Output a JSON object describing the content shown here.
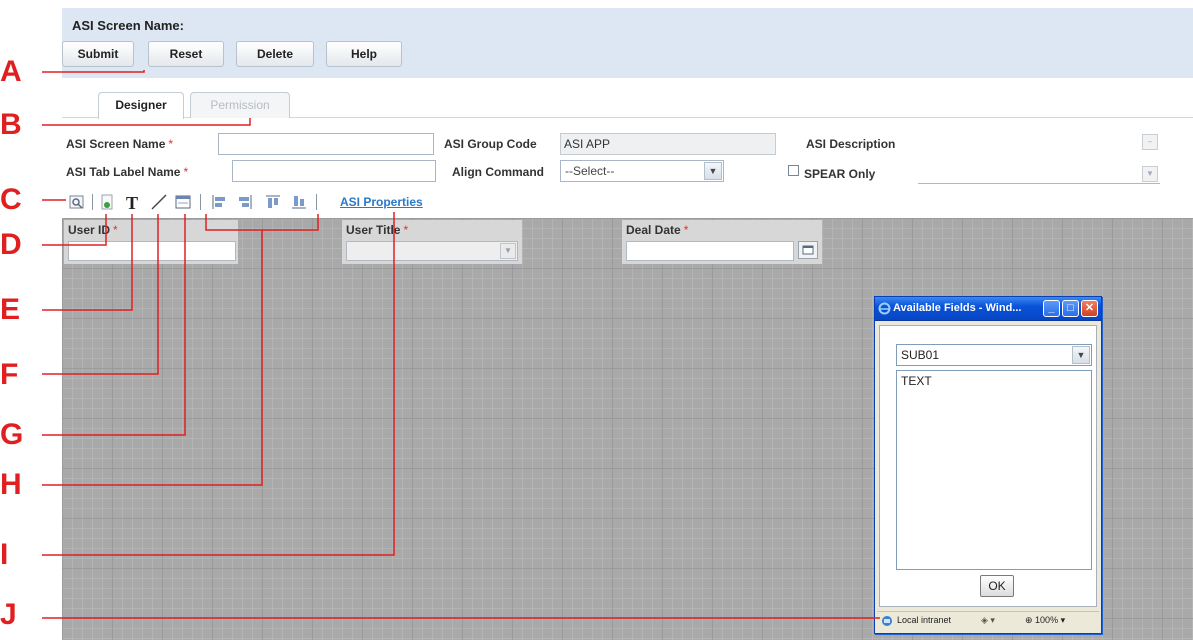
{
  "header": {
    "screen_name_label": "ASI Screen Name:",
    "buttons": [
      "Submit",
      "Reset",
      "Delete",
      "Help"
    ]
  },
  "tabs": [
    {
      "label": "Designer",
      "active": true
    },
    {
      "label": "Permission",
      "active": false
    }
  ],
  "form": {
    "screen_name": {
      "label": "ASI Screen Name",
      "required_mark": "*",
      "value": ""
    },
    "group_code": {
      "label": "ASI Group Code",
      "value": "ASI APP"
    },
    "description": {
      "label": "ASI Description",
      "value": ""
    },
    "tab_label": {
      "label": "ASI Tab Label Name",
      "required_mark": "*",
      "value": ""
    },
    "align_command": {
      "label": "Align Command",
      "selected": "--Select--"
    },
    "spear_only": {
      "label": "SPEAR Only",
      "checked": false
    }
  },
  "toolbar": {
    "icons": [
      "preview-icon",
      "add-field-icon",
      "text-icon",
      "line-icon",
      "panel-icon",
      "align-left-icon",
      "align-right-icon",
      "align-top-icon",
      "align-bottom-icon"
    ],
    "properties_link": "ASI Properties"
  },
  "canvas_fields": [
    {
      "label": "User ID",
      "required_mark": "*",
      "kind": "text"
    },
    {
      "label": "User Title",
      "required_mark": "*",
      "kind": "dropdown"
    },
    {
      "label": "Deal Date",
      "required_mark": "*",
      "kind": "date"
    }
  ],
  "popup": {
    "title": "Available Fields - Wind...",
    "selected": "SUB01",
    "list_items": [
      "TEXT"
    ],
    "ok_label": "OK",
    "status_zone": "Local intranet",
    "status_zoom": "100%"
  },
  "callouts": [
    "A",
    "B",
    "C",
    "D",
    "E",
    "F",
    "G",
    "H",
    "I",
    "J"
  ],
  "colors": {
    "header_bg": "#dde7f3",
    "canvas_bg": "#a9a9a9",
    "link": "#2a78c8",
    "required": "#e0302a",
    "callout": "#e02020",
    "popup_title": "#0a52d8"
  }
}
